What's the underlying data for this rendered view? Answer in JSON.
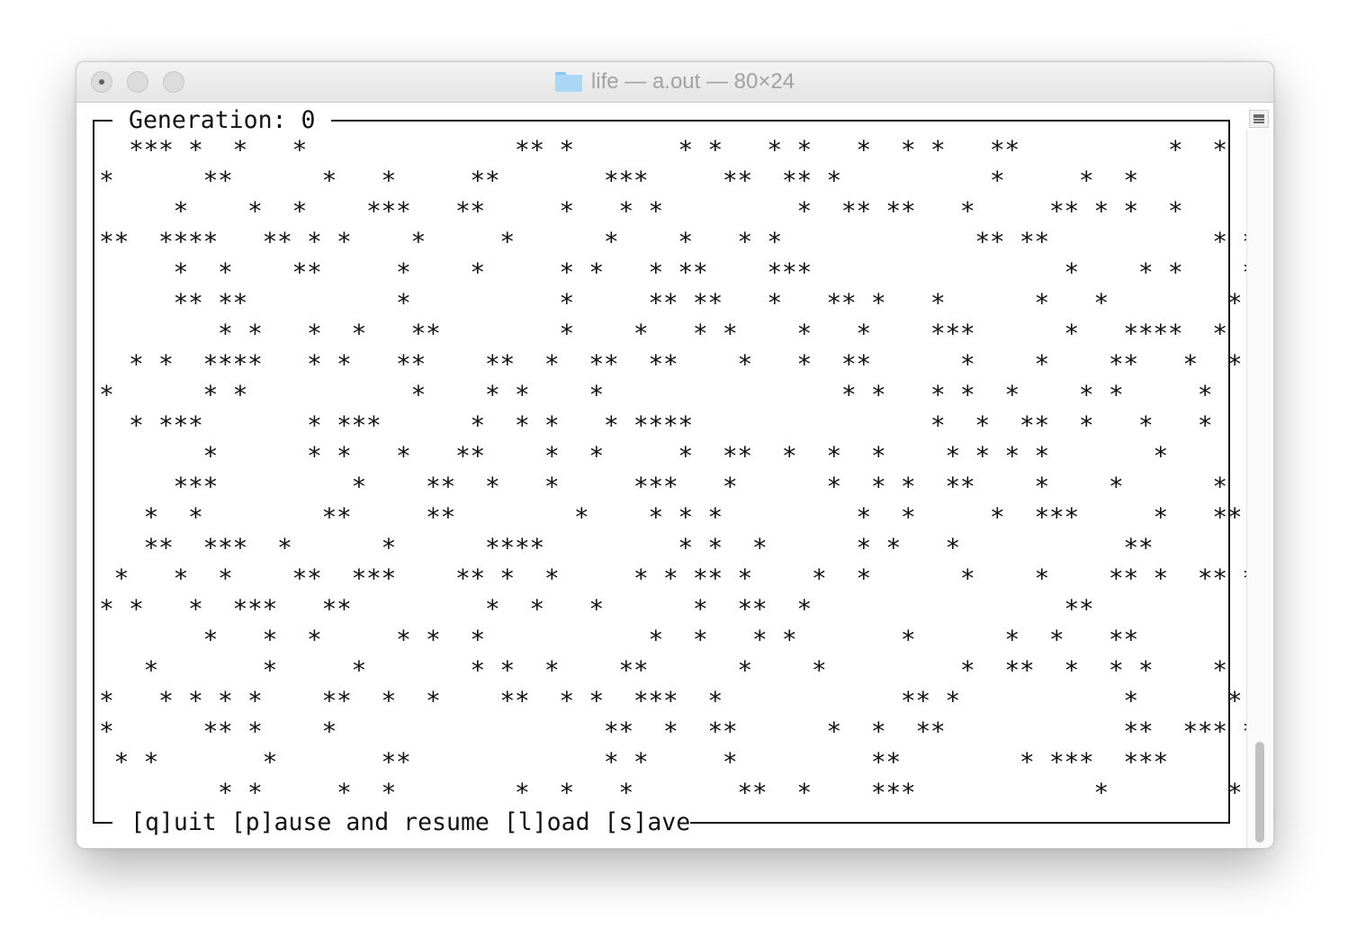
{
  "window": {
    "title": "life — a.out — 80×24",
    "folder_icon": "folder-icon"
  },
  "game": {
    "generation_label": "Generation: 0",
    "controls_label": "[q]uit [p]ause and resume [l]oad [s]ave",
    "grid_rows": [
      "  *** *  *   *              ** *       * *   * *   *  * *   **          *  *",
      "*      **      *   *     **       ***     **  ** *          *     *  *",
      "     *    *  *    ***   **     *   * *         *  ** **   *     ** * *  *      *",
      "**  ****   ** * *    *     *      *    *   * *             ** **           * *",
      "     *  *    **     *    *     * *   * **    ***                 *    * *    *",
      "     ** **          *          *     ** **   *   ** *   *      *   *        *",
      "        * *   *  *   **        *    *   * *    *   *    ***      *   ****  *",
      "  * *  ****   * *   **    **  *  **  **    *   *  **      *    *    **   *  *",
      "*      * *           *    * *    *                * *   * *  *    * *     *",
      "  * ***       * ***      *  * *   * ****                *  *  **  *   *   *",
      "       *      * *   *   **    *  *     *  **  *  *  *    * * * *       *      *",
      "     ***         *    **  *   *     ***   *      *  * *  **    *    *      *",
      "   *  *        **     **        *    * * *         *  *     *  ***     *   **",
      "   **  ***  *      *      ****         * *  *      * *   *           **",
      " *   *  *    **  ***    ** *  *     * * ** *    *  *      *    *    ** *  ** *",
      "* *   *  ***   **         *  *   *      *  **  *                 **",
      "       *   *  *     * *  *           *  *   * *       *      *  *   **        *",
      "   *       *     *       * *  *    **      *    *         *  **  *  * *    *    *",
      "*   * * * *    **  *  *    **  * *  ***  *            ** *           *      *",
      "*      ** *    *                  **  *  **      *  *  **            **  *** *",
      " * *       *       **             * *     *         **        * ***  ***      *",
      "        * *     *  *        *  *   *       **  *    ***            *        *"
    ]
  }
}
